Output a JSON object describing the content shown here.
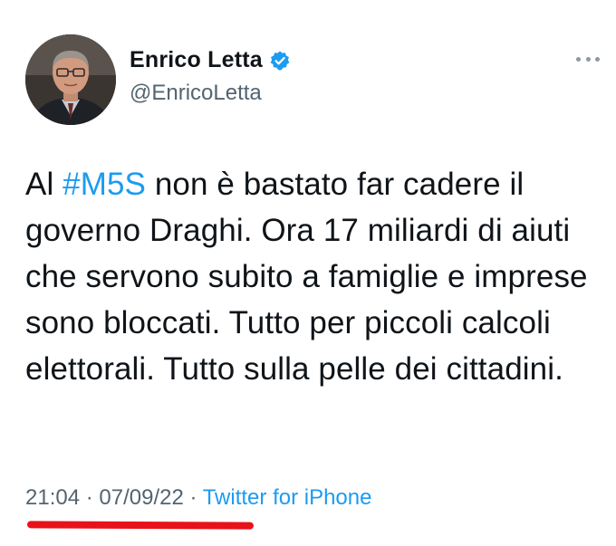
{
  "author": {
    "display_name": "Enrico Letta",
    "handle": "@EnricoLetta",
    "verified_icon": "verified-badge-icon",
    "avatar_icon": "profile-photo"
  },
  "tweet": {
    "text_before": "Al ",
    "hashtag": "#M5S",
    "text_after": " non è bastato far cadere il governo Draghi. Ora 17 miliardi di aiuti che servono subito a famiglie e imprese sono bloccati. Tutto per piccoli calcoli elettorali. Tutto sulla pelle dei cittadini."
  },
  "meta": {
    "time": "21:04",
    "date": "07/09/22",
    "separator": " · ",
    "source": "Twitter for iPhone"
  },
  "colors": {
    "accent": "#1d9bf0",
    "text": "#0f1419",
    "secondary": "#536471",
    "annotation_underline": "#e8121b"
  },
  "more_menu_icon": "more-dots-icon"
}
